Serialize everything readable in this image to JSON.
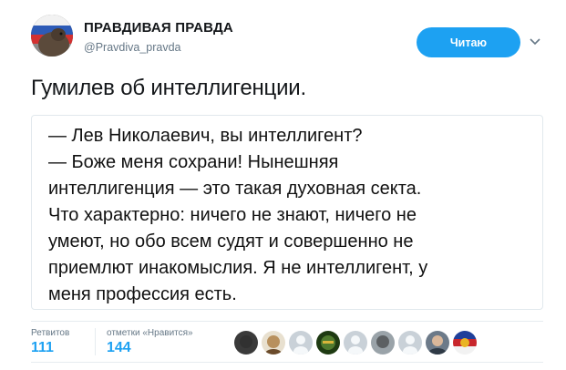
{
  "header": {
    "display_name": "ПРАВДИВАЯ ПРАВДА",
    "handle": "@Pravdiva_pravda",
    "follow_label": "Читаю"
  },
  "tweet": {
    "text": "Гумилев об интеллигенции."
  },
  "quote": {
    "lines": [
      "— Лев Николаевич, вы интеллигент?",
      "— Боже меня сохрани! Нынешняя",
      "интеллигенция — это такая духовная секта.",
      "Что характерно: ничего не знают, ничего не",
      "умеют, но обо всем судят и совершенно не",
      "приемлют инакомыслия. Я не интеллигент, у",
      "меня профессия есть."
    ]
  },
  "stats": {
    "retweets_label": "Ретвитов",
    "retweets_value": "111",
    "likes_label": "отметки «Нравится»",
    "likes_value": "144"
  },
  "likers": [
    {
      "icon": "avatar-dark-round",
      "color": "#3a3a3a"
    },
    {
      "icon": "avatar-face",
      "color": "#b8905d"
    },
    {
      "icon": "avatar-default",
      "color": "#c9d1d8"
    },
    {
      "icon": "avatar-green",
      "color": "#4f7a2e"
    },
    {
      "icon": "avatar-default",
      "color": "#c9d1d8"
    },
    {
      "icon": "avatar-grey",
      "color": "#9aa3a9"
    },
    {
      "icon": "avatar-default",
      "color": "#c9d1d8"
    },
    {
      "icon": "avatar-portrait",
      "color": "#2f3a46"
    },
    {
      "icon": "avatar-flag",
      "color": "#c8262c"
    }
  ],
  "colors": {
    "accent": "#1da1f2",
    "muted": "#657786",
    "border": "#e1e8ed"
  }
}
